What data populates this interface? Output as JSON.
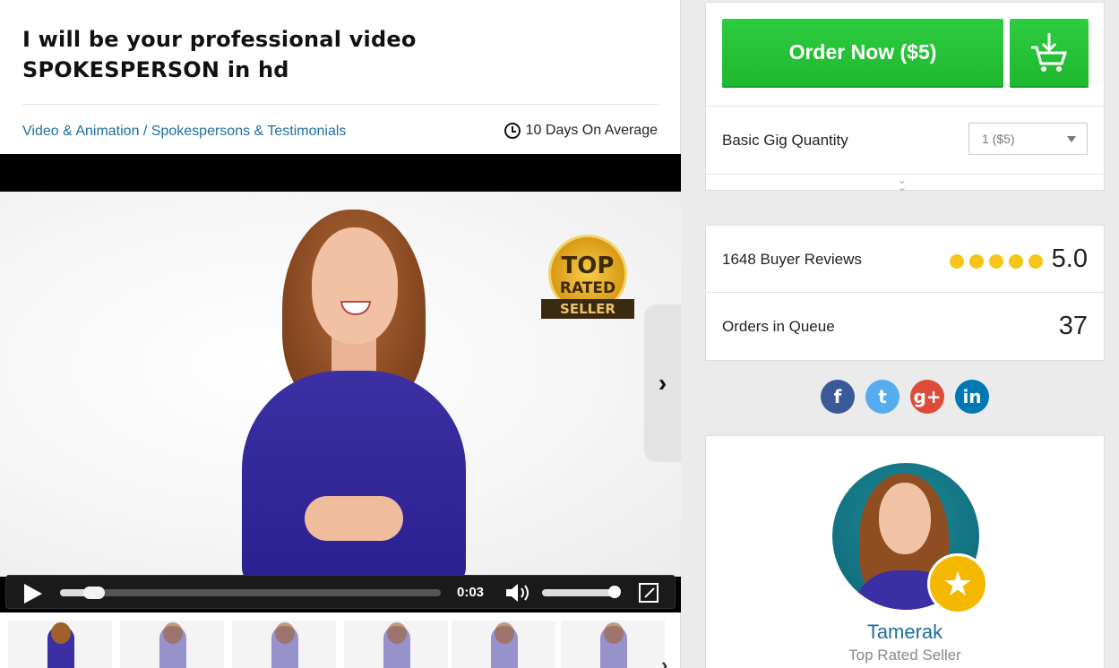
{
  "gig": {
    "title_line1": "I will be your professional video",
    "title_line2": "SPOKESPERSON in hd",
    "category": "Video & Animation",
    "separator": " / ",
    "subcategory": "Spokespersons & Testimonials",
    "delivery": "10 Days On Average"
  },
  "video": {
    "badge_top": "TOP",
    "badge_mid": "RATED",
    "badge_ribbon": "SELLER",
    "time": "0:03",
    "progress_fraction": 0.09,
    "volume_fraction": 0.95,
    "thumbnail_count": 6
  },
  "order": {
    "button_label": "Order Now ($5)",
    "quantity_label": "Basic Gig Quantity",
    "quantity_value": "1 ($5)",
    "expand_icon": "double-chevron-down-icon"
  },
  "stats": {
    "reviews_label": "1648 Buyer Reviews",
    "rating": "5.0",
    "rating_stars": 5,
    "queue_label": "Orders in Queue",
    "queue_value": "37"
  },
  "social": [
    {
      "icon": "facebook-icon",
      "glyph": "f",
      "color": "#3b5998"
    },
    {
      "icon": "twitter-icon",
      "glyph": "t",
      "color": "#55acee"
    },
    {
      "icon": "google-plus-icon",
      "glyph": "g+",
      "color": "#dd4b39"
    },
    {
      "icon": "linkedin-icon",
      "glyph": "in",
      "color": "#0077b5"
    }
  ],
  "seller": {
    "name": "Tamerak",
    "level": "Top Rated Seller"
  },
  "colors": {
    "accent_green": "#1fb830",
    "link_blue": "#1e6ea1",
    "star_gold": "#f5c518"
  }
}
